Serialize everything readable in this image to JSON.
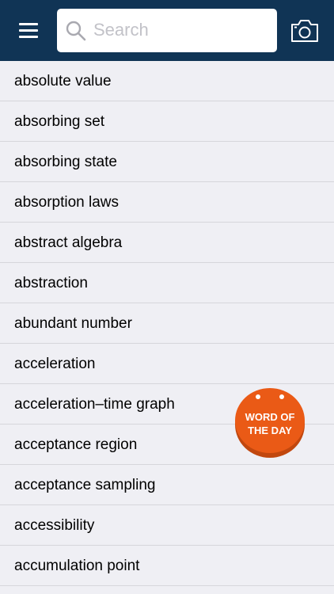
{
  "header": {
    "menu_icon": "hamburger-menu-icon",
    "search": {
      "placeholder": "Search",
      "value": "",
      "icon": "search-icon"
    },
    "camera_icon": "camera-icon"
  },
  "colors": {
    "header_bg": "#103455",
    "list_bg": "#efeff4",
    "divider": "#d6d6db",
    "word_of_the_day": "#ea5a16"
  },
  "words": [
    "absolute value",
    "absorbing set",
    "absorbing state",
    "absorption laws",
    "abstract algebra",
    "abstraction",
    "abundant number",
    "acceleration",
    "acceleration–time graph",
    "acceptance region",
    "acceptance sampling",
    "accessibility",
    "accumulation point"
  ],
  "word_of_the_day": {
    "line1": "WORD OF",
    "line2": "THE DAY"
  }
}
